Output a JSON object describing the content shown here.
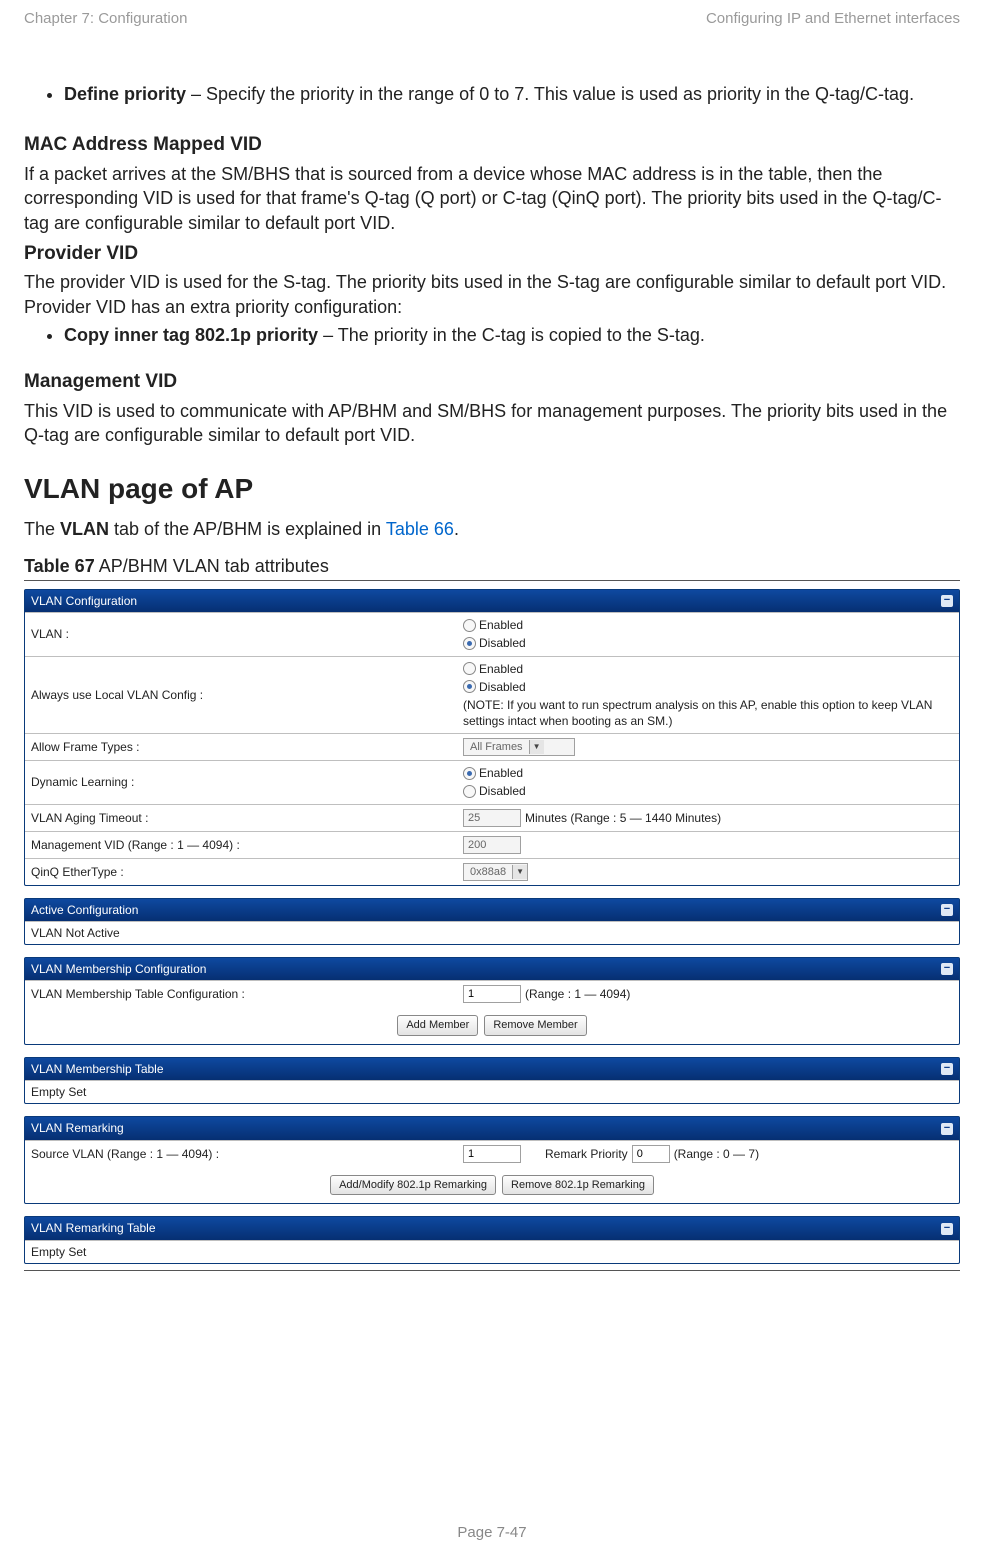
{
  "header": {
    "left": "Chapter 7:  Configuration",
    "right": "Configuring IP and Ethernet interfaces"
  },
  "body": {
    "define_priority_lead": "Define priority",
    "define_priority_rest": " – Specify the priority in the range of 0 to 7. This value is used as priority in the Q-tag/C-tag.",
    "mac_heading": "MAC Address Mapped VID",
    "mac_para": "If a packet arrives at the SM/BHS that is sourced from a device whose MAC address is in the table, then the corresponding VID is used for that frame's Q-tag (Q port) or C-tag (QinQ port). The priority bits used in the Q-tag/C-tag are configurable similar to default port VID.",
    "provider_heading": "Provider VID",
    "provider_para": "The provider VID is used for the S-tag. The priority bits used in the S-tag are configurable similar to default port VID. Provider VID has an extra priority configuration:",
    "copy_lead": "Copy inner tag 802.1p priority",
    "copy_rest": " – The priority in the C-tag is copied to the S-tag.",
    "mgmt_heading": "Management VID",
    "mgmt_para": "This VID is used to communicate with AP/BHM and SM/BHS for management purposes. The priority bits used in the Q-tag are configurable similar to default port VID.",
    "vlan_page_heading": "VLAN page of AP",
    "vlan_sentence_1": "The ",
    "vlan_sentence_2_bold": "VLAN",
    "vlan_sentence_3": " tab of the AP/BHM is explained in ",
    "vlan_sentence_4_link": "Table 66",
    "vlan_sentence_5": ".",
    "table_label_bold": "Table 67",
    "table_label_rest": " AP/BHM VLAN tab attributes"
  },
  "panel": {
    "cfg": {
      "title": "VLAN Configuration",
      "vlan_label": "VLAN :",
      "enabled": "Enabled",
      "disabled": "Disabled",
      "always_label": "Always use Local VLAN Config :",
      "note": "(NOTE: If you want to run spectrum analysis on this AP, enable this option to keep VLAN settings intact when booting as an SM.)",
      "aft_label": "Allow Frame Types :",
      "aft_value": "All Frames",
      "dyn_label": "Dynamic Learning :",
      "aging_label": "VLAN Aging Timeout :",
      "aging_value": "25",
      "aging_hint": "Minutes (Range : 5 — 1440 Minutes)",
      "mgmt_label": "Management VID (Range : 1 — 4094) :",
      "mgmt_value": "200",
      "qinq_label": "QinQ EtherType :",
      "qinq_value": "0x88a8"
    },
    "active": {
      "title": "Active Configuration",
      "body": "VLAN Not Active"
    },
    "memb_cfg": {
      "title": "VLAN Membership Configuration",
      "label": "VLAN Membership Table Configuration :",
      "value": "1",
      "hint": "(Range : 1 — 4094)",
      "add_btn": "Add Member",
      "remove_btn": "Remove Member"
    },
    "memb_tbl": {
      "title": "VLAN Membership Table",
      "body": "Empty Set"
    },
    "remark": {
      "title": "VLAN Remarking",
      "src_label": "Source VLAN (Range : 1 — 4094) :",
      "src_value": "1",
      "prio_label": "Remark Priority",
      "prio_value": "0",
      "prio_hint": "(Range : 0 — 7)",
      "add_btn": "Add/Modify 802.1p Remarking",
      "remove_btn": "Remove 802.1p Remarking"
    },
    "remark_tbl": {
      "title": "VLAN Remarking Table",
      "body": "Empty Set"
    }
  },
  "footer": "Page 7-47"
}
